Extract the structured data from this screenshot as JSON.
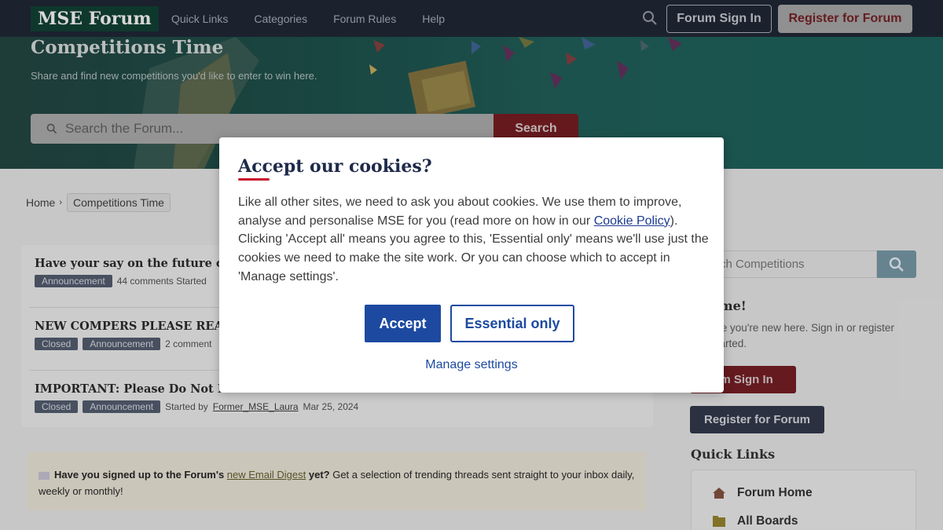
{
  "header": {
    "logo": "MSE Forum",
    "nav": [
      "Quick Links",
      "Categories",
      "Forum Rules",
      "Help"
    ],
    "signin_label": "Forum Sign In",
    "register_label": "Register for Forum"
  },
  "hero": {
    "title": "Competitions Time",
    "subtitle": "Share and find new competitions you'd like to enter to win here.",
    "search_placeholder": "Search the Forum...",
    "search_button": "Search"
  },
  "breadcrumb": {
    "home": "Home",
    "current": "Competitions Time"
  },
  "threads": [
    {
      "title": "Have your say on the future o",
      "tags": [
        "Announcement"
      ],
      "meta": "44 comments  Started"
    },
    {
      "title": "NEW COMPERS PLEASE READ",
      "tags": [
        "Closed",
        "Announcement"
      ],
      "meta": "2 comment"
    },
    {
      "title": "IMPORTANT: Please Do Not Po",
      "tags": [
        "Closed",
        "Announcement"
      ],
      "started_by": "Started by",
      "author": "Former_MSE_Laura",
      "date": "Mar 25, 2024"
    }
  ],
  "digest": {
    "lead": "Have you signed up to the Forum's",
    "link": "new Email Digest",
    "mid": "yet?",
    "rest": "Get a selection of trending threads sent straight to your inbox daily, weekly or monthly!"
  },
  "sidebar": {
    "search_placeholder": "rch Competitions",
    "welcome_title": "ome!",
    "welcome_text": "like you're new here. Sign in or register started.",
    "signin_label": "um Sign In",
    "register_label": "Register for Forum",
    "quick_links_title": "Quick Links",
    "quick_links": [
      "Forum Home",
      "All Boards"
    ]
  },
  "cookie_modal": {
    "title": "Accept our cookies?",
    "body_pre": "Like all other sites, we need to ask you about cookies. We use them to improve, analyse and personalise MSE for you (read more on how in our ",
    "policy_link": "Cookie Policy",
    "body_post": "). Clicking 'Accept all' means you agree to this, 'Essential only' means we'll use just the cookies we need to make the site work. Or you can choose which to accept in 'Manage settings'.",
    "accept_label": "Accept",
    "essential_label": "Essential only",
    "manage_label": "Manage settings",
    "accent_color": "#c8102e",
    "button_color": "#1d4aa0"
  }
}
